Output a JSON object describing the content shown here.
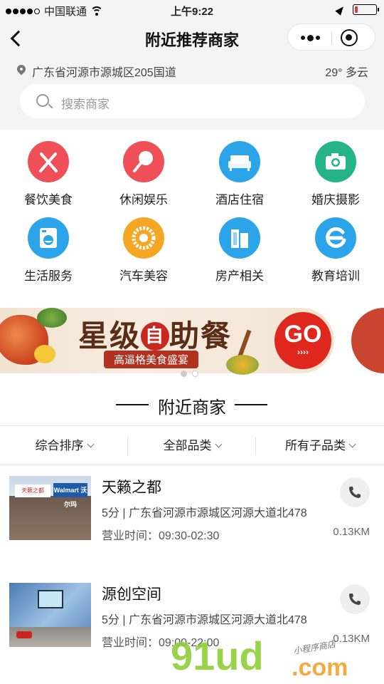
{
  "status_bar": {
    "carrier": "中国联通",
    "time": "上午9:22",
    "battery_level": 0.15
  },
  "nav": {
    "title": "附近推荐商家"
  },
  "location": {
    "address": "广东省河源市源城区205国道",
    "weather": "29° 多云"
  },
  "search": {
    "placeholder": "搜索商家"
  },
  "categories": [
    {
      "label": "餐饮美食",
      "icon": "utensils-icon",
      "color": "#ef4f57"
    },
    {
      "label": "休闲娱乐",
      "icon": "racket-icon",
      "color": "#ef4f57"
    },
    {
      "label": "酒店住宿",
      "icon": "sofa-icon",
      "color": "#2ba4ea"
    },
    {
      "label": "婚庆摄影",
      "icon": "camera-icon",
      "color": "#25b389"
    },
    {
      "label": "生活服务",
      "icon": "washing-machine-icon",
      "color": "#2ba4ea"
    },
    {
      "label": "汽车美容",
      "icon": "tire-icon",
      "color": "#f5a623"
    },
    {
      "label": "房产相关",
      "icon": "building-icon",
      "color": "#2ba4ea"
    },
    {
      "label": "教育培训",
      "icon": "education-e-icon",
      "color": "#2ba4ea"
    }
  ],
  "banner": {
    "title_a": "星级",
    "title_circle": "自",
    "title_b": "助餐",
    "subtitle": "高逼格美食盛宴",
    "cta": "GO",
    "cta_arrows": "››››"
  },
  "section": {
    "title": "附近商家"
  },
  "filters": [
    {
      "label": "综合排序"
    },
    {
      "label": "全部品类"
    },
    {
      "label": "所有子品类"
    }
  ],
  "shops": [
    {
      "name": "天籁之都",
      "info": "5分 | 广东省河源市源城区河源大道北478",
      "hours": "营业时间：09:30-02:30",
      "distance": "0.13KM",
      "sign": "Walmart 沃尔玛",
      "sign2": "天籁之都"
    },
    {
      "name": "源创空间",
      "info": "5分 | 广东省河源市源城区河源大道北478",
      "hours": "营业时间：09:00-22:00",
      "distance": "0.13KM"
    }
  ],
  "watermark": {
    "main": "91ud",
    "suffix": ".com",
    "note": "小程序商店"
  }
}
